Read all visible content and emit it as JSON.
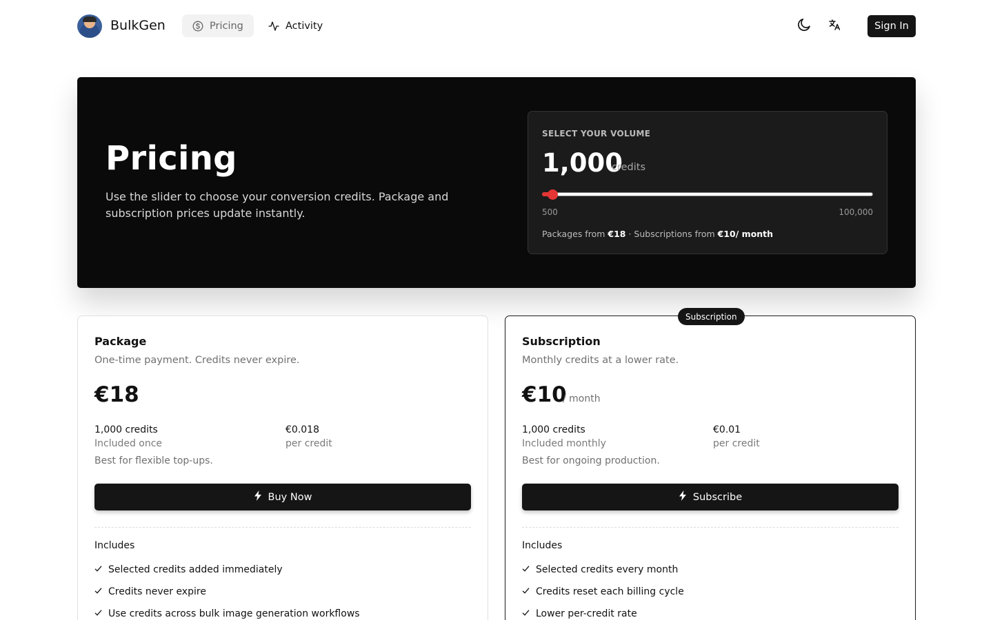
{
  "header": {
    "brand": "BulkGen",
    "nav": [
      {
        "label": "Pricing",
        "icon": "dollar-circle-icon",
        "active": true
      },
      {
        "label": "Activity",
        "icon": "activity-icon",
        "active": false
      }
    ],
    "theme_icon": "moon-icon",
    "language_icon": "translate-icon",
    "signin_label": "Sign In"
  },
  "hero": {
    "title": "Pricing",
    "subtitle": "Use the slider to choose your conversion credits. Package and subscription prices update instantly.",
    "volume": {
      "label": "SELECT YOUR VOLUME",
      "value": "1,000",
      "unit": "credits",
      "slider_min": "500",
      "slider_max": "100,000",
      "slider_position": 0.01,
      "summary_packages_prefix": "Packages from",
      "summary_packages_price": "€18",
      "summary_separator": "·",
      "summary_subs_prefix": "Subscriptions from",
      "summary_subs_price": "€10/ month"
    }
  },
  "package": {
    "title": "Package",
    "description": "One-time payment. Credits never expire.",
    "price": "€18",
    "credits": "1,000 credits",
    "credits_note": "Included once",
    "per_credit": "€0.018",
    "per_credit_note": "per credit",
    "note": "Best for flexible top-ups.",
    "cta": "Buy Now",
    "includes_label": "Includes",
    "features": [
      "Selected credits added immediately",
      "Credits never expire",
      "Use credits across bulk image generation workflows"
    ]
  },
  "subscription": {
    "badge": "Subscription",
    "title": "Subscription",
    "description": "Monthly credits at a lower rate.",
    "price": "€10",
    "period": "/ month",
    "credits": "1,000 credits",
    "credits_note": "Included monthly",
    "per_credit": "€0.01",
    "per_credit_note": "per credit",
    "note": "Best for ongoing production.",
    "cta": "Subscribe",
    "includes_label": "Includes",
    "features": [
      "Selected credits every month",
      "Credits reset each billing cycle",
      "Lower per-credit rate"
    ]
  },
  "colors": {
    "accent": "#e53535",
    "dark": "#0a0a0a",
    "button": "#151515"
  }
}
